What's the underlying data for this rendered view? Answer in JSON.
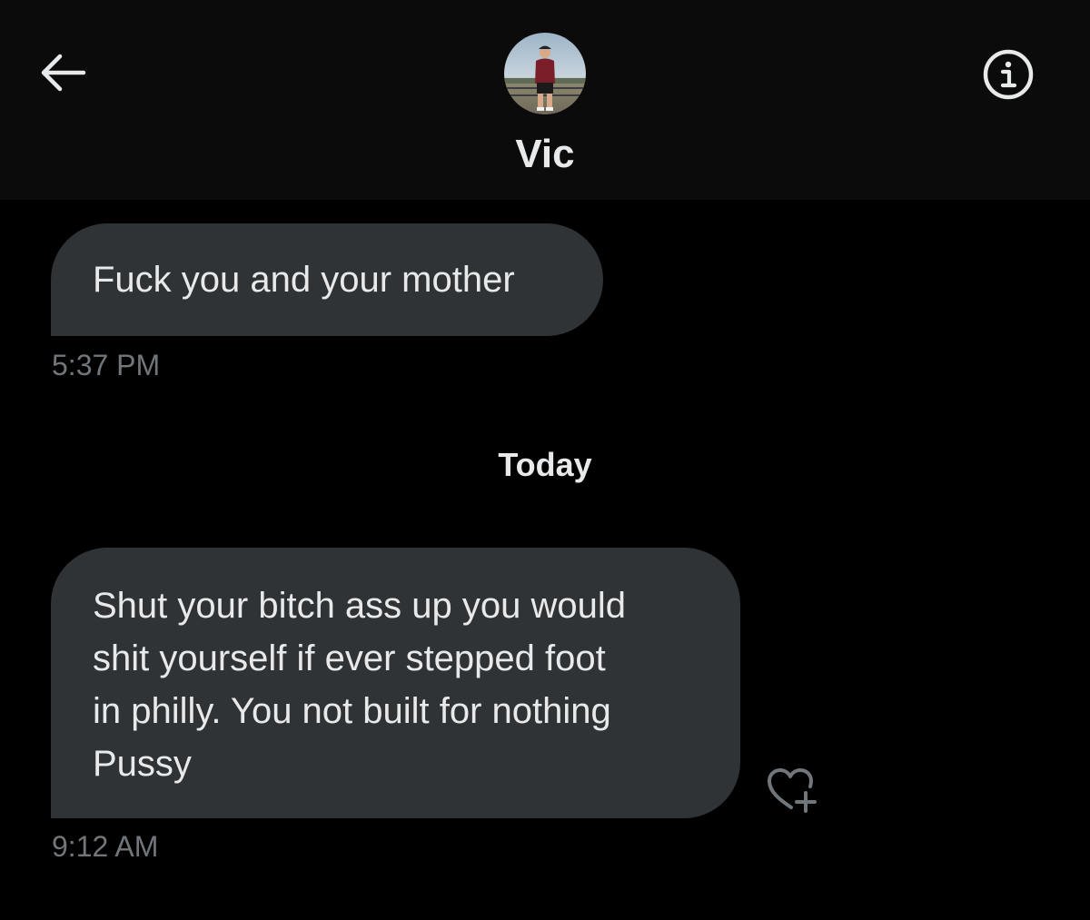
{
  "header": {
    "contact_name": "Vic",
    "back_icon": "arrow-left-icon",
    "info_icon": "info-circle-icon",
    "avatar_alt": "Vic profile photo"
  },
  "messages": [
    {
      "text": "Fuck you and your mother",
      "timestamp": "5:37 PM"
    },
    {
      "text": "Shut your bitch ass up you would\nshit yourself if ever stepped foot\nin philly. You not built for nothing\nPussy",
      "timestamp": "9:12 AM"
    }
  ],
  "date_divider": "Today",
  "reaction": {
    "icon": "heart-plus-icon"
  },
  "colors": {
    "background": "#000000",
    "header_bg": "#0b0b0b",
    "bubble_bg": "#2f3336",
    "primary_text": "#e7e9ea",
    "secondary_text": "#71767b"
  }
}
